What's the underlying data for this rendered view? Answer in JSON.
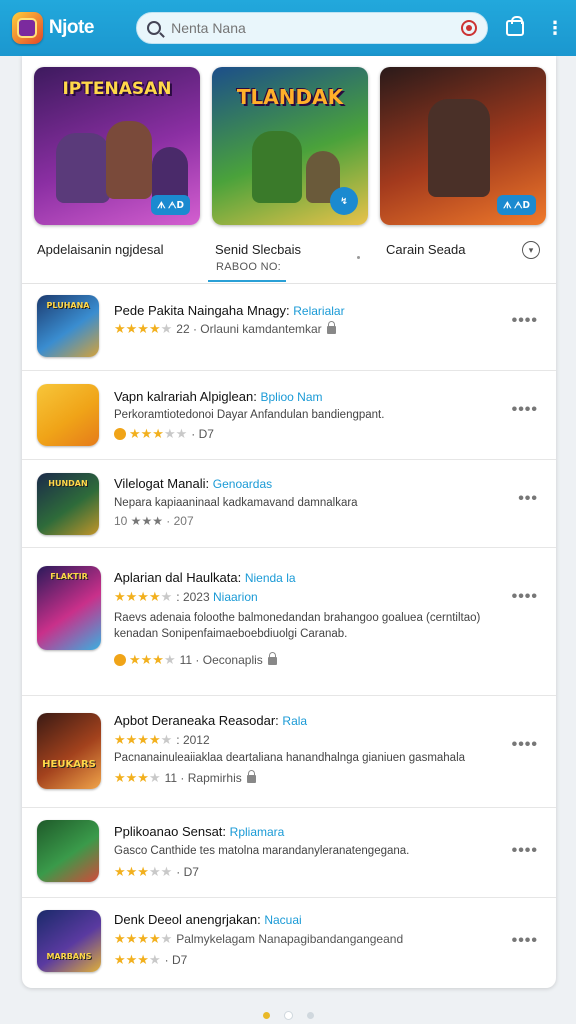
{
  "header": {
    "app_title": "Njote",
    "search_placeholder": "Nenta Nana"
  },
  "featured": [
    {
      "title": "IPTENASAN",
      "badge": "ᗑ ᗅᗞ",
      "colors": [
        "#3d1a5e",
        "#8b2fa3",
        "#d45fd0"
      ]
    },
    {
      "title": "TLANDAK",
      "badge": "↯",
      "colors": [
        "#1c4e8a",
        "#4aa23b",
        "#e9c24a"
      ]
    },
    {
      "title": "",
      "badge": "ᗑ ᗅᗞ",
      "colors": [
        "#2a1a1a",
        "#a33a1d",
        "#f07a2b"
      ]
    }
  ],
  "categories": {
    "left": "Apdelaisanin ngjdesal",
    "middle": "Senid Slecbais",
    "middle_sub": "RABOO NO:",
    "right": "Carain Seada"
  },
  "apps": [
    {
      "title": "Pede Pakita Naingaha Mnagy:",
      "tag": "Relarialar",
      "stars_full": 4,
      "stars_off": 1,
      "meta": "22 · Orlauni kamdantemkar",
      "description": "",
      "icon_label": "PLUHANA",
      "icon_colors": [
        "#1c3a6e",
        "#3a8dd0",
        "#d4a23a"
      ]
    },
    {
      "title": "Vapn kalrariah Alpiglean:",
      "tag": "Bplioo Nam",
      "stars_full": 3,
      "stars_off": 2,
      "meta": "· D7",
      "description": "Perkoramtiotedonoi Dayar Anfandulan bandiengpant.",
      "icon_label": "",
      "icon_colors": [
        "#f7c63a",
        "#f0a418",
        "#e57b1a"
      ]
    },
    {
      "title": "Vilelogat Manali:",
      "tag": "Genoardas",
      "stars_full": 3,
      "stars_off": 0,
      "meta": "10 ★★★ · 207",
      "description": "Nepara kapiaaninaal kadkamavand damnalkara",
      "icon_label": "HUNDAN",
      "icon_colors": [
        "#1b2a4a",
        "#2e6b3a",
        "#c2952a"
      ]
    },
    {
      "title": "Aplarian dal Haulkata:",
      "tag": "Nienda la",
      "stars_full": 4,
      "stars_off": 1,
      "meta": ": 2023",
      "meta_tag": "Niaarion",
      "description": "Raevs adenaia foloothe balmonedandan brahangoo goaluea (cerntiltao) kenadan Sonipenfaimaeboebdiuolgi Caranab.",
      "meta2": "11 · Oeconaplis",
      "icon_label": "FLAKTIR",
      "icon_colors": [
        "#2a1a5a",
        "#c9308a",
        "#3ab0e0"
      ]
    },
    {
      "title": "Apbot Deraneaka Reasodar:",
      "tag": "Rala",
      "stars_full": 4,
      "stars_off": 1,
      "meta": ": 2012",
      "description": "Pacnanainuleaiiaklaa deartaliana hanandhalnga gianiuen gasmahala",
      "meta2": "11 · Rapmirhis",
      "icon_label": "HEUKARS",
      "icon_colors": [
        "#3a1a14",
        "#a3421d",
        "#f0a44a"
      ]
    },
    {
      "title": "Pplikoanao Sensat:",
      "tag": "Rpliamara",
      "stars_full": 3,
      "stars_off": 2,
      "meta": "· D7",
      "description": "Gasco Canthide tes matolna marandanyleranatengegana.",
      "icon_label": "",
      "icon_colors": [
        "#1f5a2a",
        "#3a9a4a",
        "#d24a3a"
      ]
    },
    {
      "title": "Denk Deeol anengrjakan:",
      "tag": "Nacuai",
      "stars_full": 4,
      "stars_off": 1,
      "meta": "Palmykelagam Nanapagibandangangeand",
      "description": "",
      "meta2": "· D7",
      "icon_label": "MARBANS",
      "icon_colors": [
        "#1a2a6a",
        "#5a3aa0",
        "#e0b03a"
      ]
    }
  ]
}
